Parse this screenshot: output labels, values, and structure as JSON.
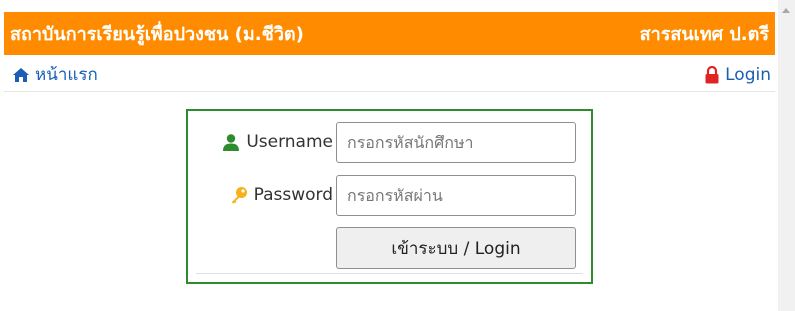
{
  "header": {
    "left_title": "สถาบันการเรียนรู้เพื่อปวงชน (ม.ชีวิต)",
    "right_title": "สารสนเทศ ป.ตรี",
    "background_color": "#ff8c00"
  },
  "nav": {
    "home_label": "หน้าแรก",
    "home_icon": "home-icon",
    "login_label": "Login",
    "login_icon": "lock-icon",
    "link_color": "#1a5fb4",
    "lock_color": "#e02424"
  },
  "form": {
    "border_color": "#2e8b2e",
    "username_label": "Username",
    "username_icon": "user-icon",
    "username_placeholder": "กรอกรหัสนักศึกษา",
    "username_value": "",
    "password_label": "Password",
    "password_icon": "key-icon",
    "password_placeholder": "กรอกรหัสผ่าน",
    "password_value": "",
    "submit_label": "เข้าระบบ / Login"
  }
}
